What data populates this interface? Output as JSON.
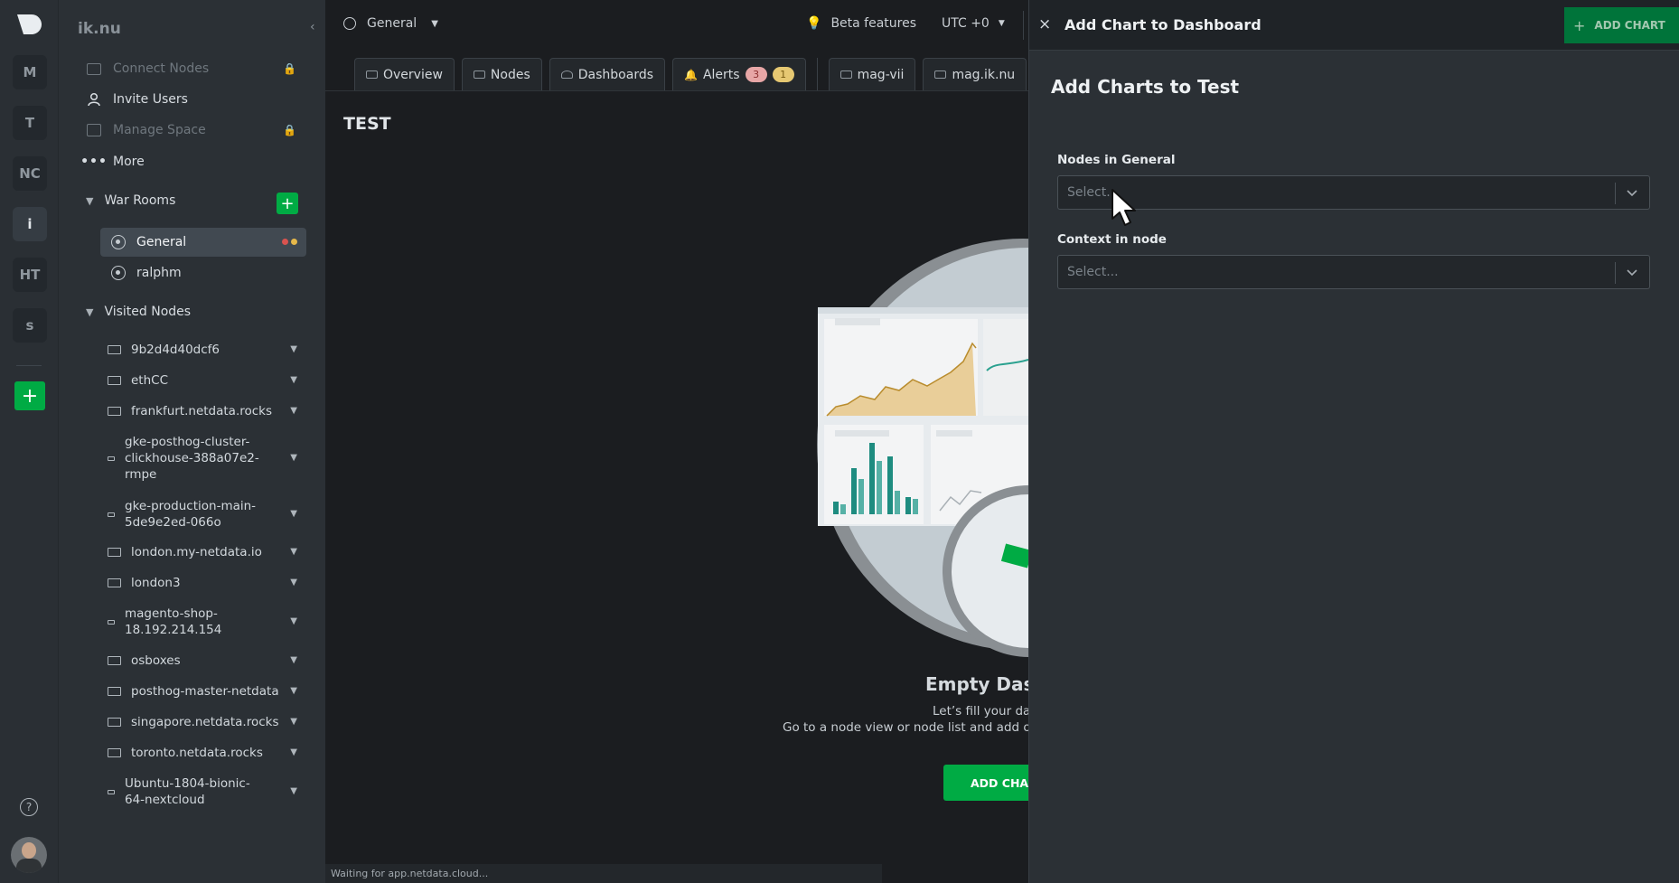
{
  "rail": {
    "spaces": [
      "M",
      "T",
      "NC",
      "i",
      "HT",
      "s"
    ],
    "active_index": 3,
    "add_label": "+",
    "help_label": "?"
  },
  "sidebar": {
    "space_name": "ik.nu",
    "collapse_label": "‹",
    "menu": [
      {
        "label": "Connect Nodes",
        "disabled": true,
        "locked": true,
        "icon": "server-icon"
      },
      {
        "label": "Invite Users",
        "disabled": false,
        "locked": false,
        "icon": "user-icon"
      },
      {
        "label": "Manage Space",
        "disabled": true,
        "locked": true,
        "icon": "manage-space-icon"
      },
      {
        "label": "More",
        "disabled": false,
        "locked": false,
        "icon": "more-dots-icon"
      }
    ],
    "war_rooms_label": "War Rooms",
    "add_room_label": "+",
    "rooms": [
      {
        "label": "General",
        "active": true
      },
      {
        "label": "ralphm",
        "active": false
      }
    ],
    "visited_nodes_label": "Visited Nodes",
    "nodes": [
      {
        "label": "9b2d4d40dcf6"
      },
      {
        "label": "ethCC"
      },
      {
        "label": "frankfurt.netdata.rocks"
      },
      {
        "label": "gke-posthog-cluster-clickhouse-388a07e2-rmpe"
      },
      {
        "label": "gke-production-main-5de9e2ed-066o"
      },
      {
        "label": "london.my-netdata.io"
      },
      {
        "label": "london3"
      },
      {
        "label": "magento-shop-18.192.214.154"
      },
      {
        "label": "osboxes"
      },
      {
        "label": "posthog-master-netdata"
      },
      {
        "label": "singapore.netdata.rocks"
      },
      {
        "label": "toronto.netdata.rocks"
      },
      {
        "label": "Ubuntu-1804-bionic-64-nextcloud"
      }
    ]
  },
  "topbar": {
    "room_selector": "General",
    "beta_features": "Beta features",
    "timezone": "UTC +0"
  },
  "tabs": {
    "overview": "Overview",
    "nodes": "Nodes",
    "dashboards": "Dashboards",
    "alerts": "Alerts",
    "alerts_critical": "3",
    "alerts_warning": "1",
    "node_tab_1": "mag-vii",
    "node_tab_2": "mag.ik.nu"
  },
  "main": {
    "page_title": "TEST",
    "empty_title": "Empty Dash",
    "empty_line1": "Let’s fill your das",
    "empty_line2": "Go to a node view or node list and add one c",
    "empty_button": "ADD CHART"
  },
  "status_bar": "Waiting for app.netdata.cloud...",
  "panel": {
    "close_label": "×",
    "title": "Add Chart to Dashboard",
    "add_chart_button": "ADD CHART",
    "subtitle": "Add Charts to Test",
    "nodes_label": "Nodes in General",
    "nodes_placeholder": "Select...",
    "context_label": "Context in node",
    "context_placeholder": "Select..."
  },
  "colors": {
    "accent_green": "#00ab44",
    "critical_badge": "#e7a6a6",
    "warning_badge": "#e6c872"
  }
}
